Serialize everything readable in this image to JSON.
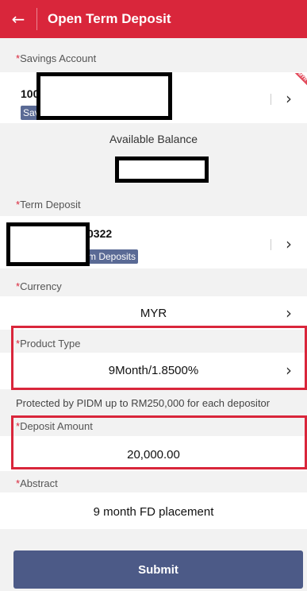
{
  "header": {
    "back_icon": "←",
    "title": "Open Term Deposit"
  },
  "savings": {
    "label": "Savings Account",
    "account_prefix": "10000",
    "type_chip": "Saving",
    "ribbon": "MYR",
    "available_balance_label": "Available Balance"
  },
  "term_deposit": {
    "label": "Term Deposit",
    "account_suffix": "0322",
    "type_chip": "rm Deposits"
  },
  "currency": {
    "label": "Currency",
    "value": "MYR"
  },
  "product_type": {
    "label": "Product Type",
    "value": "9Month/1.8500%",
    "note": "Protected by PIDM up to RM250,000 for each depositor"
  },
  "deposit_amount": {
    "label": "Deposit Amount",
    "value": "20,000.00"
  },
  "abstract": {
    "label": "Abstract",
    "value": "9 month FD placement"
  },
  "submit_label": "Submit",
  "chevron": "›",
  "required_mark": "*",
  "colors": {
    "brand_red": "#d9263b",
    "chip_blue": "#5a6a95",
    "submit_blue": "#4c5a87"
  }
}
